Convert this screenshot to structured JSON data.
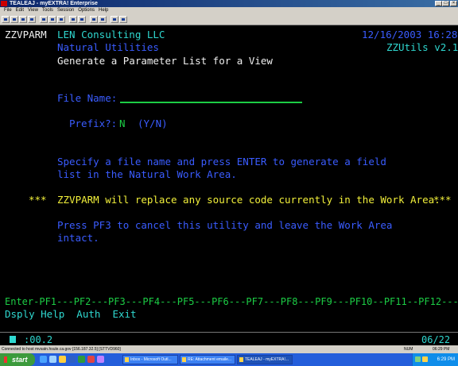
{
  "window": {
    "title": "TEALEAJ - myEXTRA! Enterprise",
    "menu": [
      "File",
      "Edit",
      "View",
      "Tools",
      "Session",
      "Options",
      "Help"
    ]
  },
  "terminal": {
    "program": "ZZVPARM",
    "company": "LEN Consulting LLC",
    "datetime": "12/16/2003 16:28",
    "subtitle": "Natural Utilities",
    "version": "ZZUtils v2.1",
    "heading": "Generate a Parameter List for a View",
    "file_name_label": "File Name:",
    "prefix_label": "Prefix?:",
    "prefix_value": "N",
    "prefix_options": "(Y/N)",
    "info_line1": "Specify a file name and press ENTER to generate a field",
    "info_line2": "list in the Natural Work Area.",
    "warn_left": "***",
    "warning": "ZZVPARM will replace any source code currently in the Work Area.",
    "warn_right": "***",
    "cancel_line1": "Press PF3 to cancel this utility and leave the Work Area",
    "cancel_line2": "intact.",
    "pf_keys_line": "Enter-PF1---PF2---PF3---PF4---PF5---PF6---PF7---PF8---PF9---PF10--PF11--PF12---",
    "pf_labels_line": "Dsply Help  Auth  Exit"
  },
  "oia": {
    "timer": ":00.2",
    "cursor": "06/22"
  },
  "status_bar": {
    "connection": "Connected to host mvsatn.hsule.ca.gov [156.187.32.5] [STTVD960]",
    "mode": "NUM",
    "time": "06:29 PM"
  },
  "taskbar": {
    "start_label": "start",
    "tasks": [
      "Inbox - Microsoft Outl...",
      "RE: Attachment emaile...",
      "TEALEAJ - myEXTRA!..."
    ],
    "clock": "6:29 PM"
  }
}
